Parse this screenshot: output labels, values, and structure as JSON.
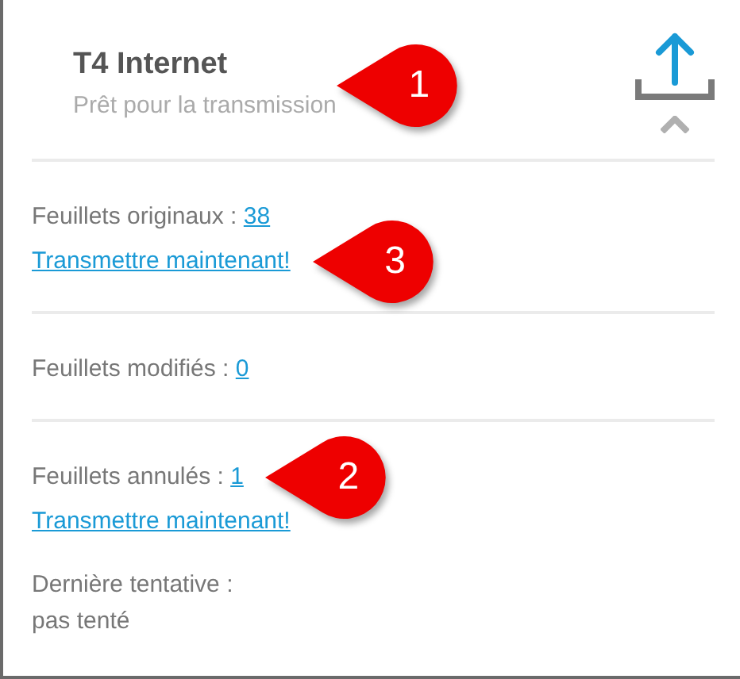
{
  "header": {
    "title": "T4 Internet",
    "subtitle": "Prêt pour la transmission",
    "callout": "1"
  },
  "sections": [
    {
      "rows": [
        {
          "kind": "count",
          "label": "Feuillets originaux :",
          "value": "38"
        },
        {
          "kind": "link",
          "text": "Transmettre maintenant!",
          "callout": "3"
        }
      ]
    },
    {
      "rows": [
        {
          "kind": "count",
          "label": "Feuillets modifiés :",
          "value": "0"
        }
      ]
    },
    {
      "rows": [
        {
          "kind": "count",
          "label": "Feuillets annulés :",
          "value": "1",
          "callout": "2"
        },
        {
          "kind": "link",
          "text": "Transmettre maintenant!"
        },
        {
          "kind": "text",
          "text": "Dernière tentative :"
        },
        {
          "kind": "text",
          "text": "pas tenté"
        }
      ]
    }
  ]
}
